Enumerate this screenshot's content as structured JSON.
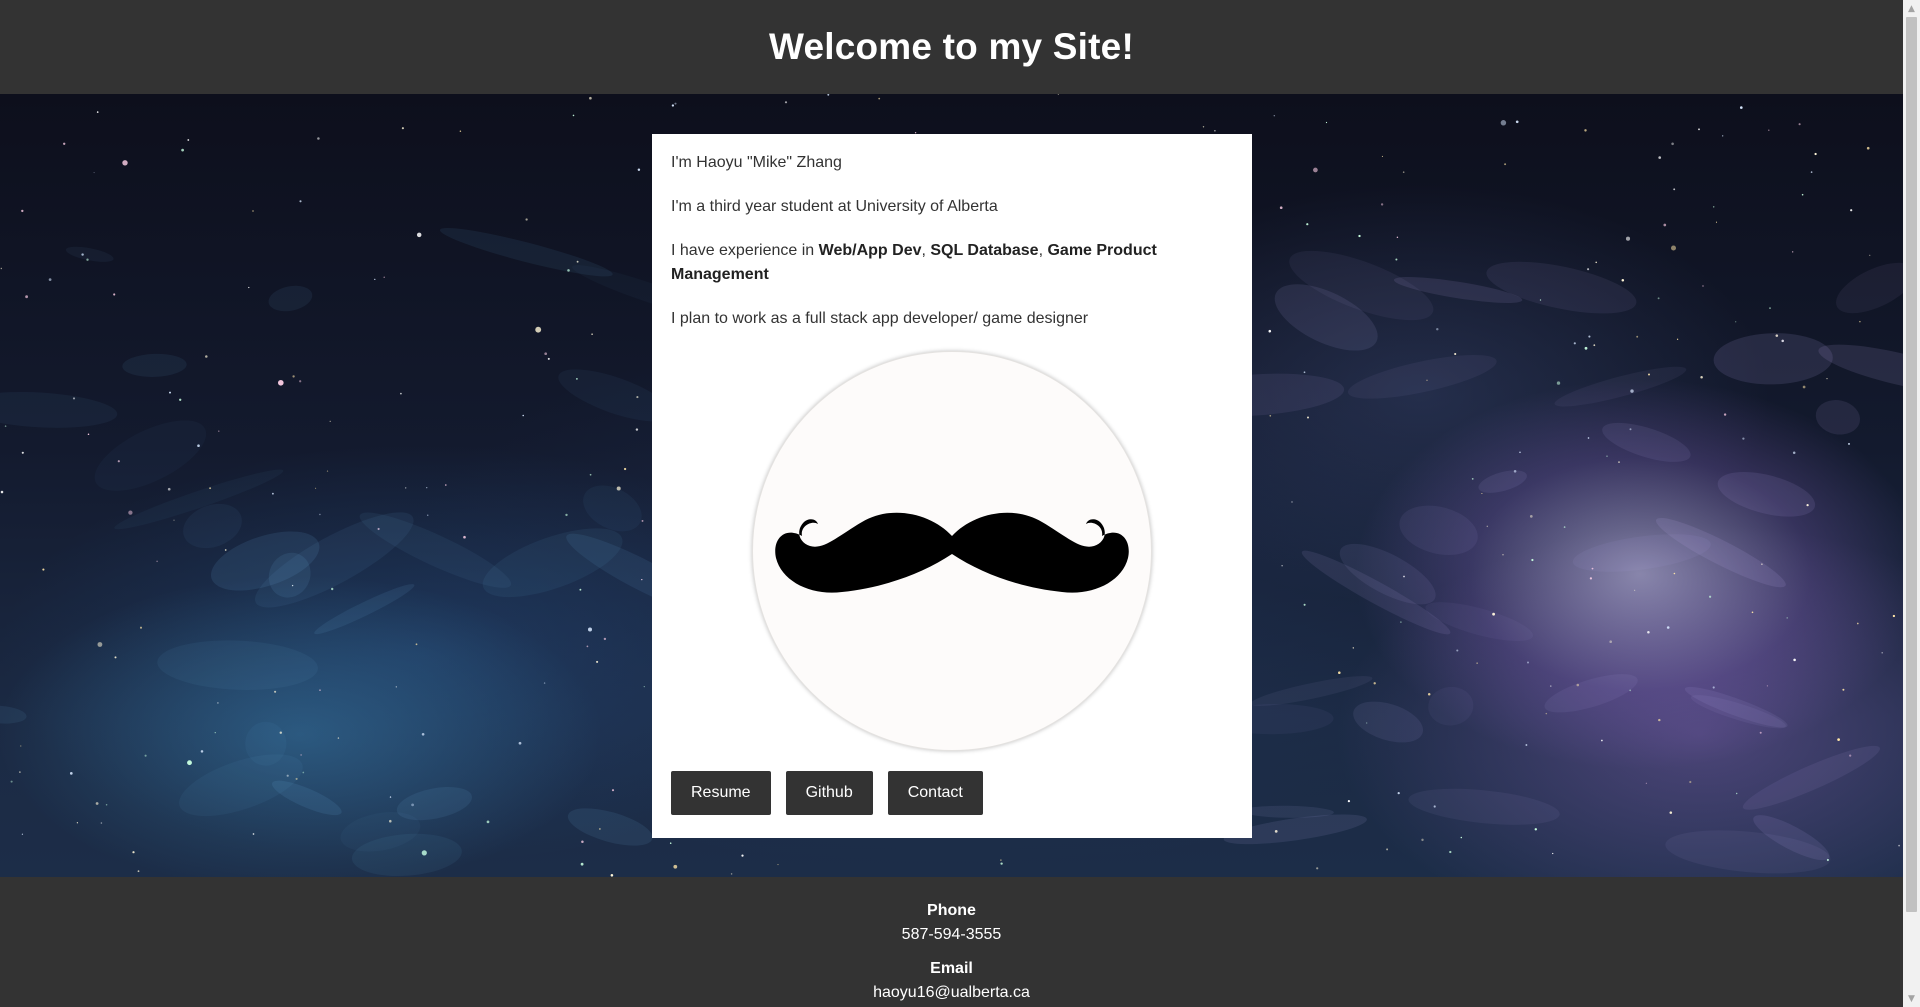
{
  "header": {
    "title": "Welcome to my Site!"
  },
  "intro": {
    "line1": "I'm Haoyu \"Mike\" Zhang",
    "line2": "I'm a third year student at University of Alberta",
    "experience_prefix": "I have experience in ",
    "skill1": "Web/App Dev",
    "sep1": ", ",
    "skill2": "SQL Database",
    "sep2": ", ",
    "skill3": "Game Product Management",
    "line4": "I plan to work as a full stack app developer/ game designer"
  },
  "avatar": {
    "icon": "mustache-icon"
  },
  "buttons": {
    "resume": "Resume",
    "github": "Github",
    "contact": "Contact"
  },
  "footer": {
    "phone_label": "Phone",
    "phone_value": "587-594-3555",
    "email_label": "Email",
    "email_value": "haoyu16@ualberta.ca"
  },
  "colors": {
    "dark": "#333333",
    "card": "#ffffff",
    "text": "#333333"
  }
}
